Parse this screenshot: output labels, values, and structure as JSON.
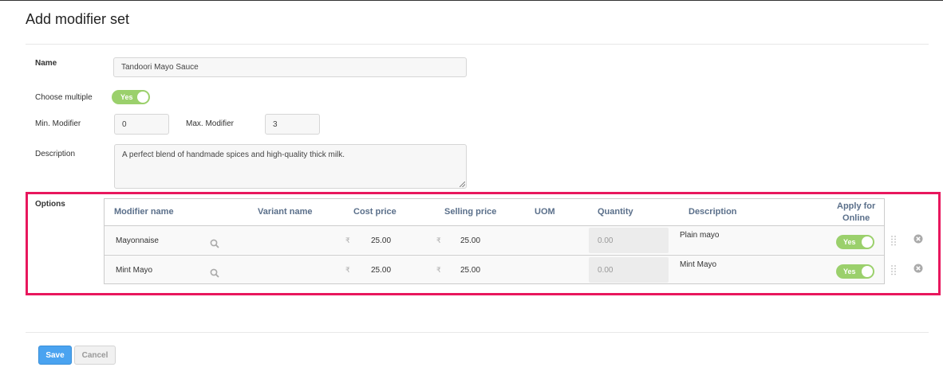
{
  "page": {
    "title": "Add modifier set"
  },
  "form": {
    "name_label": "Name",
    "name_value": "Tandoori Mayo Sauce",
    "choose_multiple_label": "Choose multiple",
    "choose_multiple_value": "Yes",
    "min_modifier_label": "Min. Modifier",
    "min_modifier_value": "0",
    "max_modifier_label": "Max. Modifier",
    "max_modifier_value": "3",
    "description_label": "Description",
    "description_value": "A perfect blend of handmade spices and high-quality thick milk.",
    "options_label": "Options"
  },
  "options_table": {
    "headers": {
      "modifier_name": "Modifier name",
      "variant_name": "Variant name",
      "cost_price": "Cost price",
      "selling_price": "Selling price",
      "uom": "UOM",
      "quantity": "Quantity",
      "description": "Description",
      "apply_online_line1": "Apply for",
      "apply_online_line2": "Online"
    },
    "currency_symbol": "₹",
    "rows": [
      {
        "modifier_name": "Mayonnaise",
        "cost_price": "25.00",
        "selling_price": "25.00",
        "quantity": "0.00",
        "description": "Plain mayo",
        "apply_online": "Yes"
      },
      {
        "modifier_name": "Mint Mayo",
        "cost_price": "25.00",
        "selling_price": "25.00",
        "quantity": "0.00",
        "description": "Mint Mayo",
        "apply_online": "Yes"
      }
    ]
  },
  "footer": {
    "save_label": "Save",
    "cancel_label": "Cancel"
  },
  "colors": {
    "accent_toggle": "#9bd06c",
    "highlight_border": "#e8175d",
    "save_button": "#4aa3f0",
    "header_text": "#5a6f8a"
  },
  "icons": [
    "search-icon",
    "drag-handle-icon",
    "remove-icon"
  ]
}
